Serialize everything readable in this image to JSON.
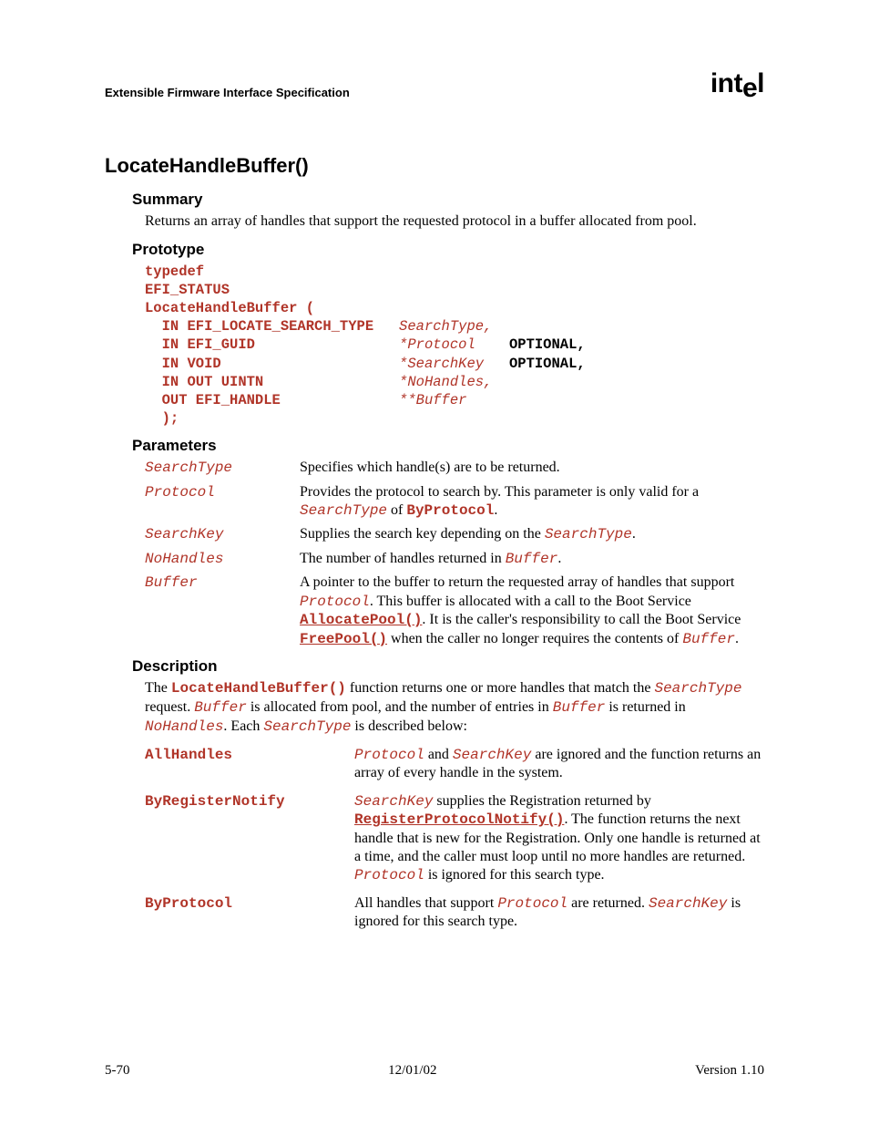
{
  "header": {
    "left": "Extensible Firmware Interface Specification",
    "logo_prefix": "int",
    "logo_drop": "e",
    "logo_suffix": "l"
  },
  "title": "LocateHandleBuffer()",
  "summary": {
    "heading": "Summary",
    "text": "Returns an array of handles that support the requested protocol in a buffer allocated from pool."
  },
  "prototype": {
    "heading": "Prototype",
    "lines": [
      {
        "kw": "typedef"
      },
      {
        "kw": "EFI_STATUS"
      },
      {
        "kw": "LocateHandleBuffer ("
      },
      {
        "kw": "  IN EFI_LOCATE_SEARCH_TYPE   ",
        "it": "SearchType,",
        "opt": ""
      },
      {
        "kw": "  IN EFI_GUID                 ",
        "it": "*Protocol    ",
        "opt": "OPTIONAL,"
      },
      {
        "kw": "  IN VOID                     ",
        "it": "*SearchKey   ",
        "opt": "OPTIONAL,"
      },
      {
        "kw": "  IN OUT UINTN                ",
        "it": "*NoHandles,",
        "opt": ""
      },
      {
        "kw": "  OUT EFI_HANDLE              ",
        "it": "**Buffer",
        "opt": ""
      },
      {
        "kw": "  );"
      }
    ]
  },
  "parameters": {
    "heading": "Parameters",
    "rows": [
      {
        "name": "SearchType",
        "desc_parts": [
          {
            "t": "Specifies which handle(s) are to be returned."
          }
        ]
      },
      {
        "name": "Protocol",
        "desc_parts": [
          {
            "t": "Provides the protocol to search by.   This parameter is only valid for a "
          },
          {
            "mi": "SearchType"
          },
          {
            "t": " of "
          },
          {
            "mb": "ByProtocol"
          },
          {
            "t": "."
          }
        ]
      },
      {
        "name": "SearchKey",
        "desc_parts": [
          {
            "t": "Supplies the search key depending on the "
          },
          {
            "mi": "SearchType"
          },
          {
            "t": "."
          }
        ]
      },
      {
        "name": "NoHandles",
        "desc_parts": [
          {
            "t": "The number of handles returned in "
          },
          {
            "mi": "Buffer"
          },
          {
            "t": "."
          }
        ]
      },
      {
        "name": "Buffer",
        "desc_parts": [
          {
            "t": "A pointer to the buffer to return the requested array of handles that support "
          },
          {
            "mi": "Protocol"
          },
          {
            "t": ".  This buffer is allocated with a call to the Boot Service "
          },
          {
            "ml": "AllocatePool()"
          },
          {
            "t": ".  It is the caller's responsibility to call the Boot Service "
          },
          {
            "ml": "FreePool()"
          },
          {
            "t": " when the caller no longer requires the contents of "
          },
          {
            "mi": "Buffer"
          },
          {
            "t": "."
          }
        ]
      }
    ]
  },
  "description": {
    "heading": "Description",
    "intro_parts": [
      {
        "t": "The "
      },
      {
        "mb": "LocateHandleBuffer()"
      },
      {
        "t": " function returns one or more handles that match the "
      },
      {
        "mi": "SearchType"
      },
      {
        "t": " request.  "
      },
      {
        "mi": "Buffer"
      },
      {
        "t": " is allocated from pool, and the number of entries in "
      },
      {
        "mi": "Buffer"
      },
      {
        "t": " is returned in "
      },
      {
        "mi": "NoHandles"
      },
      {
        "t": ".  Each "
      },
      {
        "mi": "SearchType"
      },
      {
        "t": " is described below:"
      }
    ],
    "searchtypes": [
      {
        "name": "AllHandles",
        "desc_parts": [
          {
            "mi": "Protocol"
          },
          {
            "t": " and "
          },
          {
            "mi": "SearchKey"
          },
          {
            "t": " are ignored and the function returns an array of every handle in the system."
          }
        ]
      },
      {
        "name": "ByRegisterNotify",
        "desc_parts": [
          {
            "mi": "SearchKey"
          },
          {
            "t": " supplies the Registration returned by "
          },
          {
            "ml": "RegisterProtocolNotify()"
          },
          {
            "t": ".  The function returns the next handle that is new for the Registration.  Only one handle is returned at a time, and the caller must loop until no more handles are returned.  "
          },
          {
            "mi": "Protocol"
          },
          {
            "t": " is ignored for this search type."
          }
        ]
      },
      {
        "name": "ByProtocol",
        "desc_parts": [
          {
            "t": "All handles that support "
          },
          {
            "mi": "Protocol"
          },
          {
            "t": " are returned.  "
          },
          {
            "mi": "SearchKey"
          },
          {
            "t": " is ignored for this search type."
          }
        ]
      }
    ]
  },
  "footer": {
    "left": "5-70",
    "center": "12/01/02",
    "right": "Version 1.10"
  }
}
